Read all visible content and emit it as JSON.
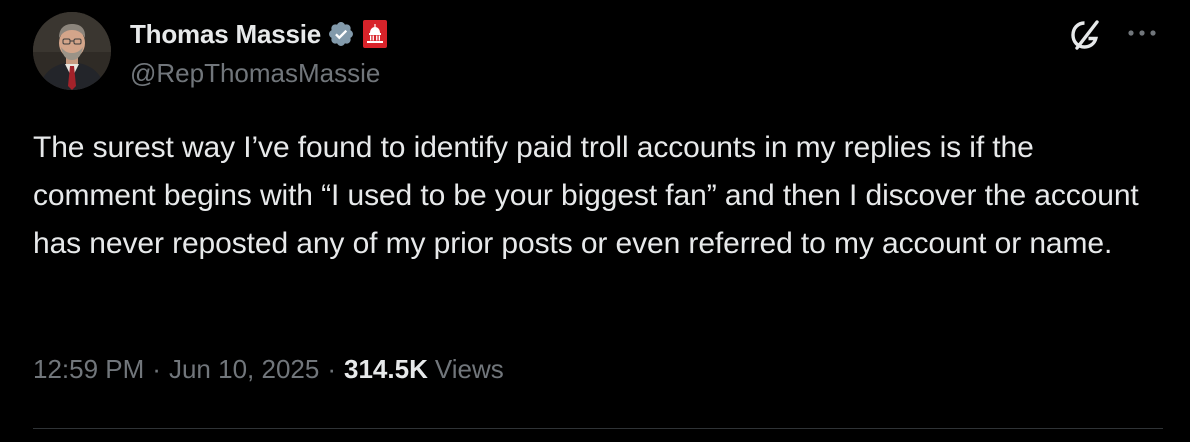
{
  "author": {
    "display_name": "Thomas Massie",
    "handle": "@RepThomasMassie",
    "verified_badge_icon": "verified-badge-icon",
    "affiliation_icon": "capitol-dome-icon",
    "avatar": "avatar"
  },
  "actions": {
    "grok_icon": "grok-icon",
    "more_icon": "more-options-icon"
  },
  "post": {
    "text": "The surest way I’ve found to identify paid troll accounts in my replies is if the comment begins with “I used to be your biggest fan” and then I discover the account has never reposted any of my prior posts or even referred to my account or name."
  },
  "meta": {
    "time": "12:59 PM",
    "separator": "·",
    "date": "Jun 10, 2025",
    "views_count": "314.5K",
    "views_label": "Views"
  },
  "colors": {
    "background": "#000000",
    "primary_text": "#e7e9ea",
    "secondary_text": "#71767b",
    "verified_badge": "#829aab",
    "affiliation_badge": "#d8232a",
    "divider": "#2f3336"
  }
}
